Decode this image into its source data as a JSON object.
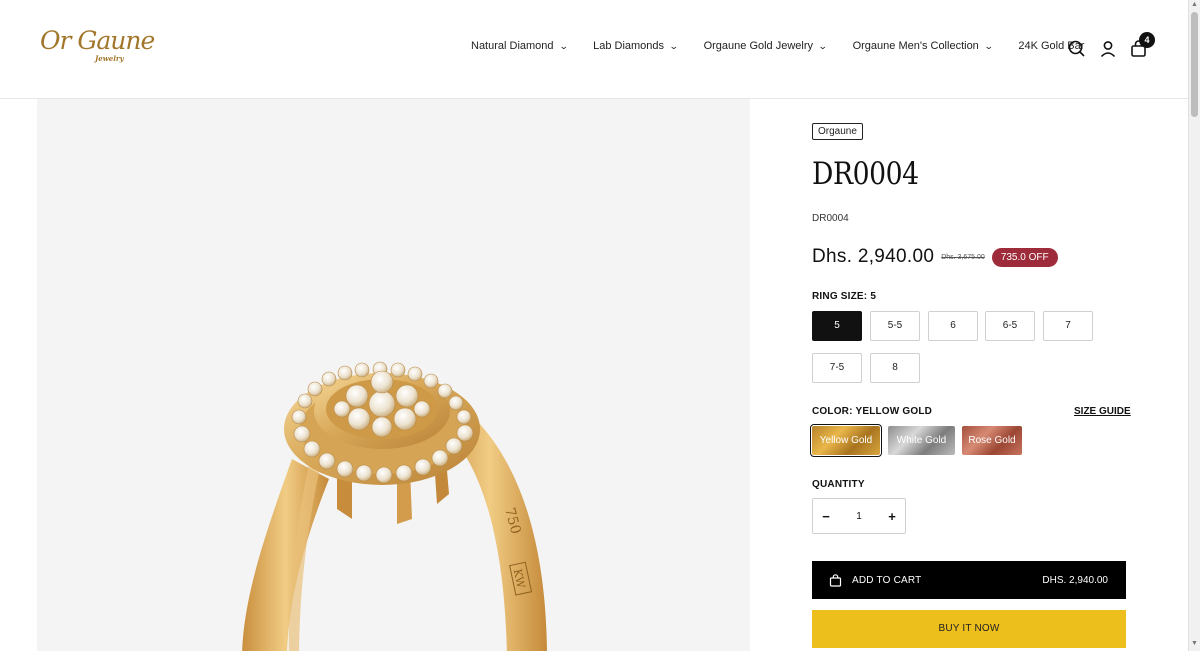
{
  "brand": {
    "logo_script": "Or Gaune",
    "logo_sub": "Jewelry"
  },
  "nav": {
    "items": [
      {
        "label": "Natural Diamond",
        "has_dropdown": true
      },
      {
        "label": "Lab Diamonds",
        "has_dropdown": true
      },
      {
        "label": "Orgaune Gold Jewelry",
        "has_dropdown": true
      },
      {
        "label": "Orgaune Men's Collection",
        "has_dropdown": true
      },
      {
        "label": "24K Gold Bar",
        "has_dropdown": false
      }
    ]
  },
  "header_icons": {
    "search": "search-icon",
    "account": "account-icon",
    "cart": "cart-icon",
    "cart_count": "4"
  },
  "product": {
    "vendor": "Orgaune",
    "title": "DR0004",
    "sku": "DR0004",
    "price": "Dhs. 2,940.00",
    "compare_price": "Dhs. 3,675.00",
    "discount_badge": "735.0 OFF",
    "ring_size_label": "RING SIZE:",
    "ring_size_value": "5",
    "sizes": [
      "5",
      "5-5",
      "6",
      "6-5",
      "7",
      "7-5",
      "8"
    ],
    "selected_size": "5",
    "color_label": "COLOR:",
    "color_value": "YELLOW GOLD",
    "size_guide": "SIZE GUIDE",
    "colors": [
      "Yellow Gold",
      "White Gold",
      "Rose Gold"
    ],
    "selected_color": "Yellow Gold",
    "quantity_label": "QUANTITY",
    "quantity": "1",
    "add_to_cart": "ADD TO CART",
    "add_to_cart_price": "DHS. 2,940.00",
    "buy_now": "BUY IT NOW"
  },
  "image": {
    "engraving_karat": "750",
    "engraving_mark": "KW"
  },
  "colors": {
    "accent_discount": "#9e2b3a",
    "buy_now": "#ecbf1d",
    "logo_gold": "#a2772c",
    "gallery_bg": "#f4f4f5"
  }
}
